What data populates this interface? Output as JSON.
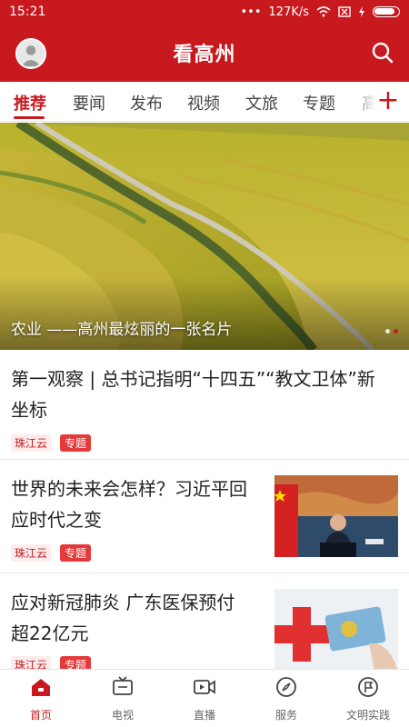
{
  "status": {
    "time": "15:21",
    "network": "127K/s",
    "dots": "•••"
  },
  "header": {
    "title": "看高州"
  },
  "tabs": [
    {
      "label": "推荐",
      "active": true
    },
    {
      "label": "要闻"
    },
    {
      "label": "发布"
    },
    {
      "label": "视频"
    },
    {
      "label": "文旅"
    },
    {
      "label": "专题"
    },
    {
      "label": "高州"
    }
  ],
  "plus_label": "+",
  "banner": {
    "caption": "农业 ——高州最炫丽的一张名片",
    "dots": 2,
    "active_dot": 2
  },
  "articles": [
    {
      "title_line1": "第一观察 | 总书记指明“十四五”“教文卫体”新",
      "title_line2": "坐标",
      "source": "珠江云",
      "tag": "专题"
    },
    {
      "title_line1": "世界的未来会怎样？习近平回",
      "title_line2": "应时代之变",
      "source": "珠江云",
      "tag": "专题"
    },
    {
      "title_line1": "应对新冠肺炎 广东医保预付",
      "title_line2": "超22亿元",
      "source": "珠江云",
      "tag": "专题"
    }
  ],
  "bottom_nav": [
    {
      "label": "首页",
      "icon": "home-icon",
      "active": true
    },
    {
      "label": "电视",
      "icon": "tv-icon"
    },
    {
      "label": "直播",
      "icon": "live-video-icon"
    },
    {
      "label": "服务",
      "icon": "compass-icon"
    },
    {
      "label": "文明实践",
      "icon": "flag-badge-icon"
    }
  ],
  "colors": {
    "brand_red": "#c8191f",
    "tag_red": "#e33a3a"
  }
}
